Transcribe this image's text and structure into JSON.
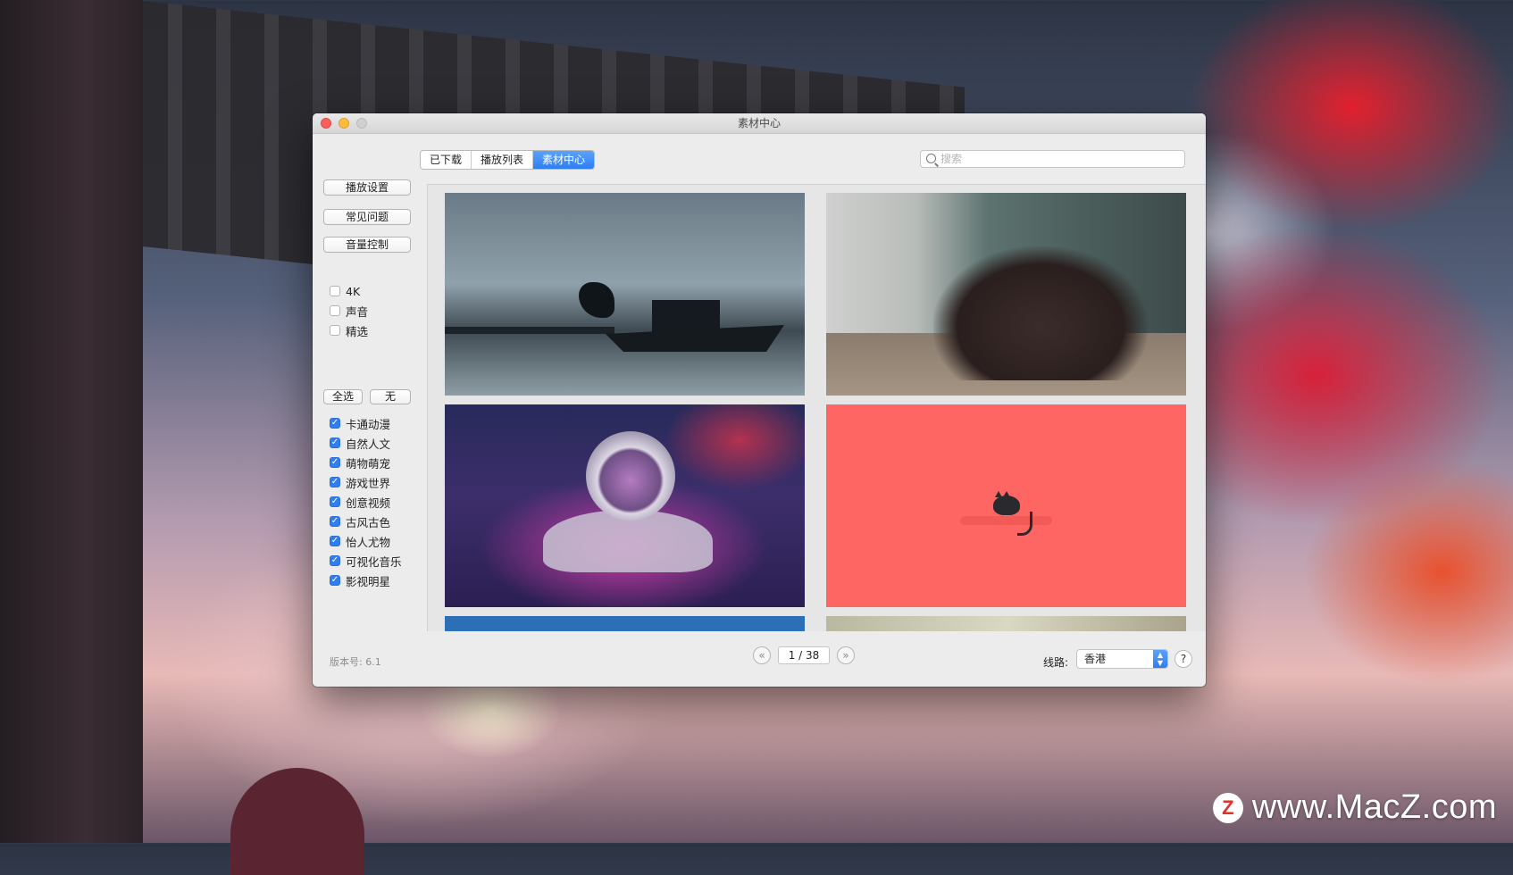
{
  "window": {
    "title": "素材中心"
  },
  "tabs": [
    {
      "label": "已下载",
      "active": false
    },
    {
      "label": "播放列表",
      "active": false
    },
    {
      "label": "素材中心",
      "active": true
    }
  ],
  "search": {
    "placeholder": "搜索",
    "value": ""
  },
  "sidebar": {
    "buttons": [
      "播放设置",
      "常见问题",
      "音量控制"
    ],
    "filters": [
      {
        "label": "4K",
        "checked": false
      },
      {
        "label": "声音",
        "checked": false
      },
      {
        "label": "精选",
        "checked": false
      }
    ],
    "select_all_label": "全选",
    "select_none_label": "无",
    "categories": [
      {
        "label": "卡通动漫",
        "checked": true
      },
      {
        "label": "自然人文",
        "checked": true
      },
      {
        "label": "萌物萌宠",
        "checked": true
      },
      {
        "label": "游戏世界",
        "checked": true
      },
      {
        "label": "创意视频",
        "checked": true
      },
      {
        "label": "古风古色",
        "checked": true
      },
      {
        "label": "怡人尤物",
        "checked": true
      },
      {
        "label": "可视化音乐",
        "checked": true
      },
      {
        "label": "影视明星",
        "checked": true
      }
    ]
  },
  "footer": {
    "version": "版本号: 6.1",
    "page": "1 / 38",
    "prev_icon": "double-chevron-left-icon",
    "next_icon": "double-chevron-right-icon",
    "route_label": "线路:",
    "route_value": "香港",
    "help_label": "?"
  },
  "watermark": {
    "logo": "Z",
    "text": "www.MacZ.com"
  },
  "colors": {
    "accent": "#2f7ef1",
    "window_bg": "#ececec",
    "cat_tile": "#fe6664"
  }
}
